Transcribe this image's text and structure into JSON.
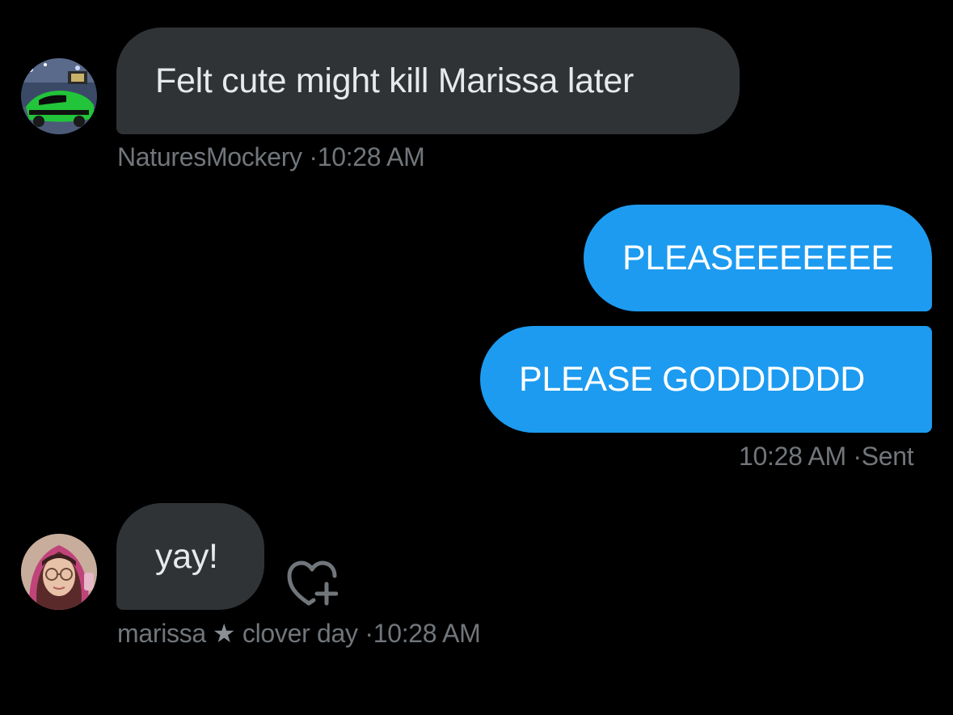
{
  "conversation": {
    "messages": [
      {
        "direction": "received",
        "text": "Felt cute might kill Marissa later",
        "sender": "NaturesMockery",
        "separator": "·",
        "time": "10:28 AM",
        "avatar_icon": "green-race-car-avatar"
      },
      {
        "direction": "sent",
        "text": "PLEASEEEEEEE"
      },
      {
        "direction": "sent",
        "text": "PLEASE GODDDDDD",
        "time": "10:28 AM",
        "separator": "·",
        "status": "Sent"
      },
      {
        "direction": "received",
        "text": "yay!",
        "sender": "marissa",
        "star": "★",
        "sender_suffix": "clover day",
        "separator": "·",
        "time": "10:28 AM",
        "avatar_icon": "pink-hair-person-avatar",
        "reaction_icon": "add-reaction-heart-icon"
      }
    ]
  },
  "colors": {
    "background": "#000000",
    "received_bubble": "#2f3336",
    "sent_bubble": "#1d9bf0",
    "meta_text": "#71767b"
  }
}
